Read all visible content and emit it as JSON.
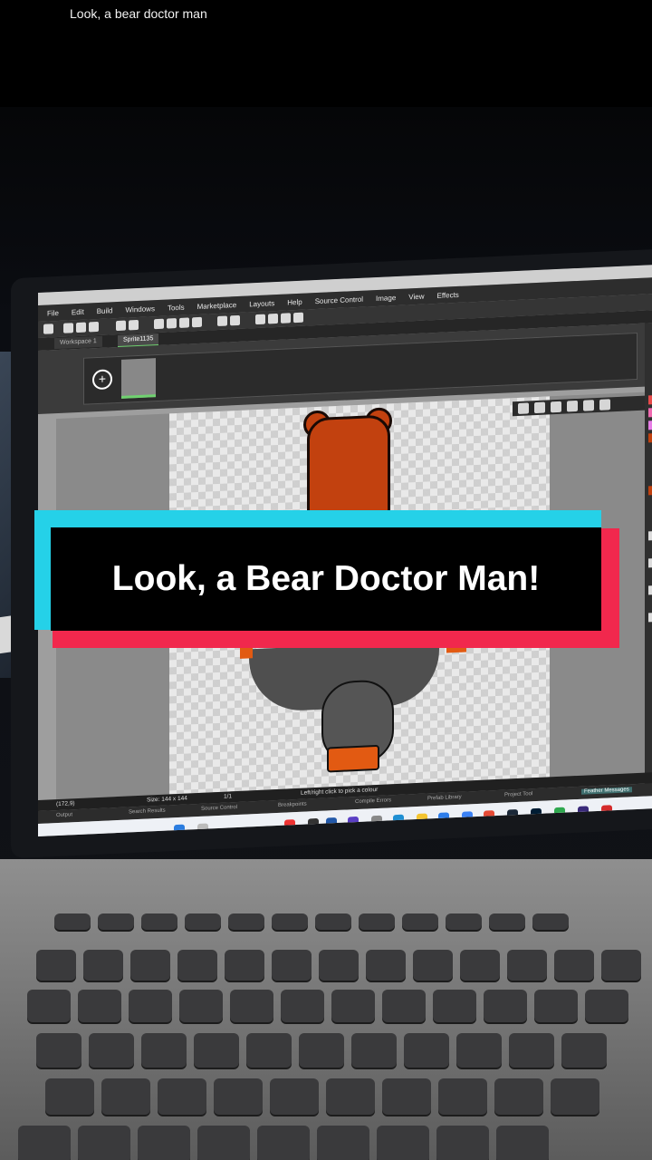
{
  "top_caption": "Look, a bear doctor man",
  "overlay_caption": "Look, a Bear Doctor Man!",
  "app": {
    "menu": [
      "File",
      "Edit",
      "Build",
      "Windows",
      "Tools",
      "Marketplace",
      "Layouts",
      "Help",
      "Source Control",
      "Image",
      "View",
      "Effects"
    ],
    "tabs": [
      "Workspace 1",
      "Sprite1135"
    ],
    "status": {
      "coords": "(172,9)",
      "size": "Size: 144 x 144",
      "frame": "1/1",
      "hint": "Left/right click to pick a colour"
    },
    "bottom_tabs": [
      "Output",
      "Search Results",
      "Source Control",
      "Breakpoints",
      "Compile Errors",
      "Prefab Library",
      "Project Tool",
      "Feather Messages"
    ],
    "output_label": "Feather Messages"
  },
  "colors": {
    "cyan": "#25d1e8",
    "red": "#f1284d",
    "bear_fur": "#c2410f",
    "suit_gray": "#555555"
  }
}
